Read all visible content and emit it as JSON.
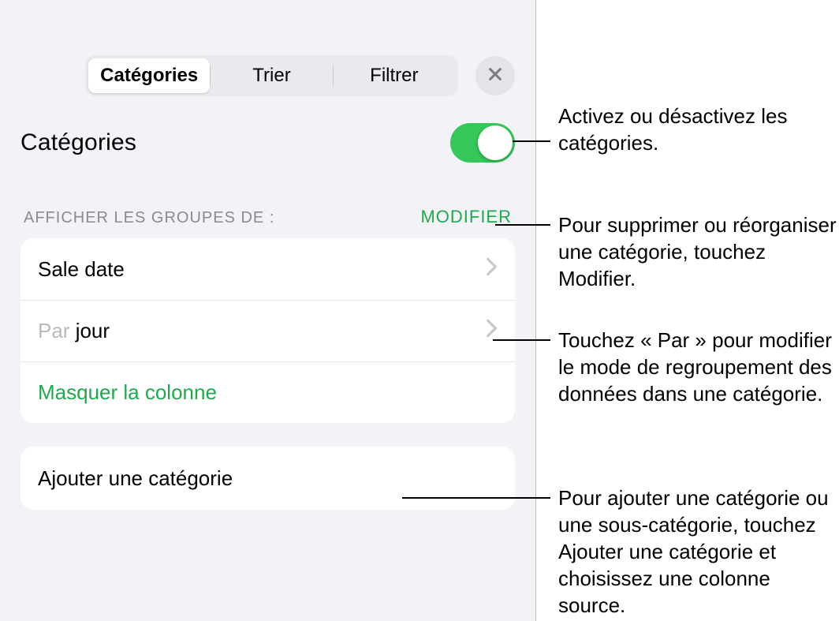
{
  "tabs": {
    "categories": "Catégories",
    "sort": "Trier",
    "filter": "Filtrer"
  },
  "header": {
    "title": "Catégories"
  },
  "section": {
    "label": "AFFICHER LES GROUPES DE :",
    "action": "MODIFIER"
  },
  "rows": {
    "sale_date": "Sale date",
    "by_prefix": "Par ",
    "by_value": "jour",
    "hide_col": "Masquer la colonne",
    "add_cat": "Ajouter une catégorie"
  },
  "callouts": {
    "toggle": "Activez ou désactivez les catégories.",
    "modify": "Pour supprimer ou réorganiser une catégorie, touchez Modifier.",
    "by": "Touchez « Par » pour modifier le mode de regroupement des données dans une catégorie.",
    "add": "Pour ajouter une catégorie ou une sous-catégorie, touchez Ajouter une catégorie et choisissez une colonne source."
  }
}
